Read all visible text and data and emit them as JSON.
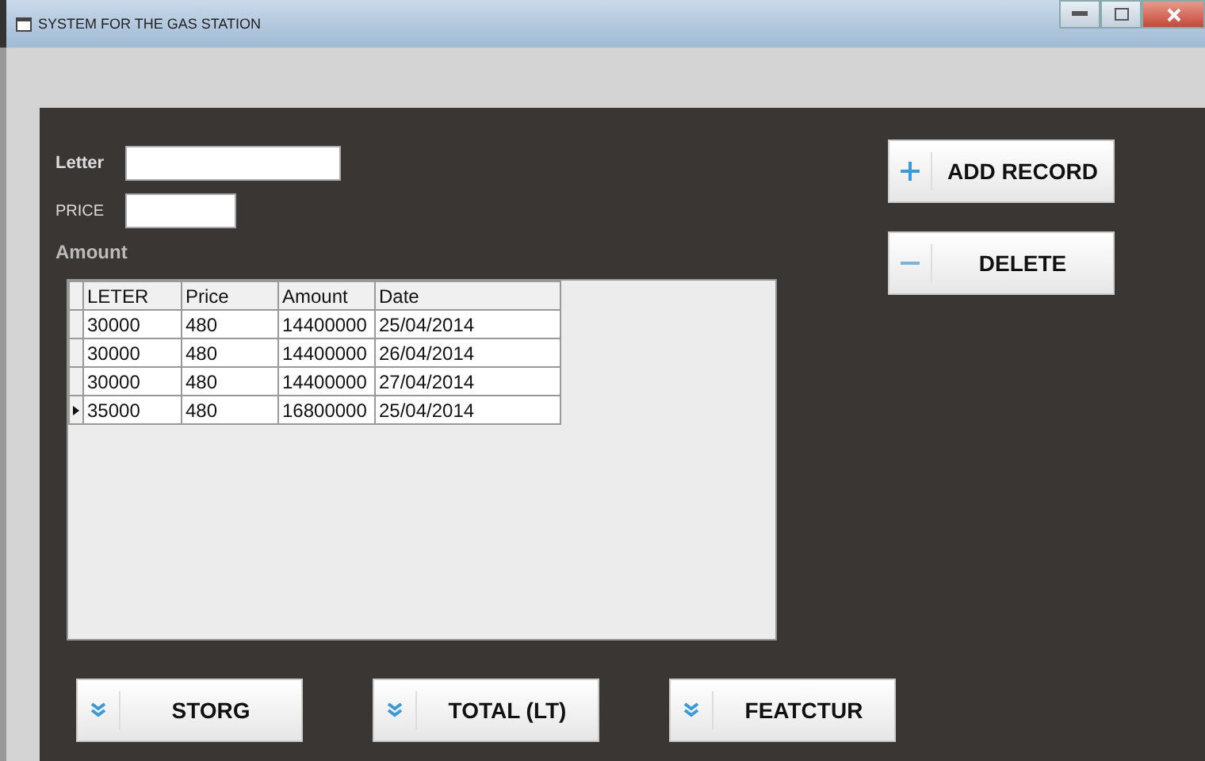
{
  "window": {
    "title": "SYSTEM FOR THE GAS STATION"
  },
  "fields": [
    {
      "label": "Letter"
    },
    {
      "label": "PRICE"
    }
  ],
  "amount_label": "Amount",
  "table": {
    "columns": [
      "LETER",
      "Price",
      "Amount",
      "Date"
    ],
    "rows": [
      {
        "cells": [
          "30000",
          "480",
          "14400000",
          "25/04/2014"
        ],
        "selected": false
      },
      {
        "cells": [
          "30000",
          "480",
          "14400000",
          "26/04/2014"
        ],
        "selected": false
      },
      {
        "cells": [
          "30000",
          "480",
          "14400000",
          "27/04/2014"
        ],
        "selected": false
      },
      {
        "cells": [
          "35000",
          "480",
          "16800000",
          "25/04/2014"
        ],
        "selected": true
      }
    ]
  },
  "side_buttons": [
    {
      "label": "ADD RECORD",
      "kind": "plus"
    },
    {
      "label": "DELETE",
      "kind": "minus"
    }
  ],
  "bottom_buttons": [
    {
      "label": "STORG",
      "kind": "chevrons"
    },
    {
      "label": "TOTAL (LT)",
      "kind": "chevrons"
    },
    {
      "label": "FEATCTUR",
      "kind": "chevrons"
    }
  ]
}
